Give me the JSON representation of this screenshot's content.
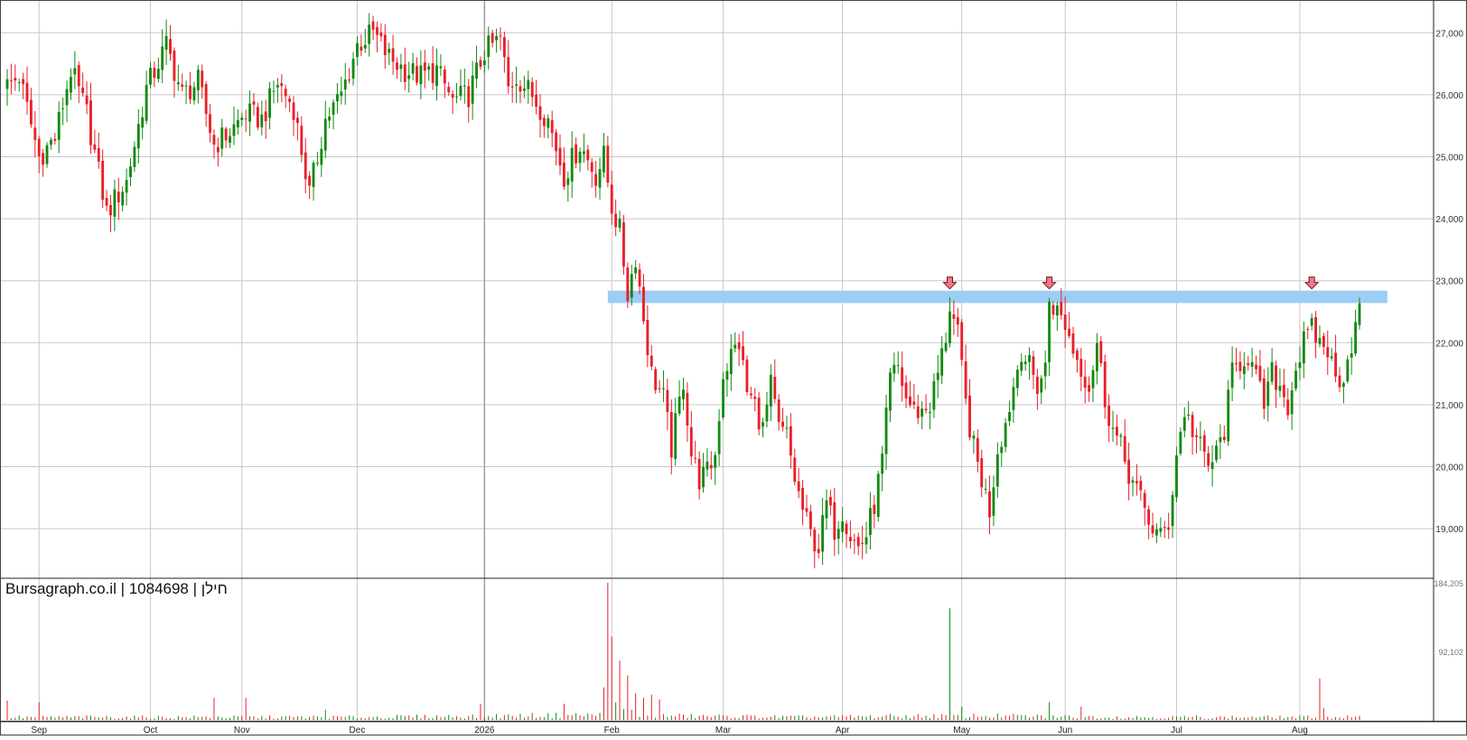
{
  "watermark": "Bursagraph.co.il | 1084698 | חילן",
  "colors": {
    "up": "#138a13",
    "down": "#e8202a",
    "grid": "#c8c8c8",
    "resistance": "#9ccdf5",
    "arrow": "#f07a8a"
  },
  "chart_data": {
    "type": "candlestick",
    "title": "",
    "xlabel": "",
    "ylabel": "",
    "grid": true,
    "price_axis": {
      "ticks": [
        19000,
        20000,
        21000,
        22000,
        23000,
        24000,
        25000,
        26000,
        27000
      ],
      "tick_labels": [
        "19,000",
        "20,000",
        "21,000",
        "22,000",
        "23,000",
        "24,000",
        "25,000",
        "26,000",
        "27,000"
      ],
      "ylim": [
        18200,
        27500
      ]
    },
    "volume_axis": {
      "ticks": [
        92102,
        184205
      ],
      "tick_labels": [
        "92,102",
        "184,205"
      ],
      "ylim": [
        0,
        184205
      ]
    },
    "x_labels": [
      "Sep",
      "Oct",
      "Nov",
      "Dec",
      "2026",
      "Feb",
      "Mar",
      "Apr",
      "May",
      "Jun",
      "Jul",
      "Aug"
    ],
    "x_label_index": [
      8,
      36,
      59,
      88,
      120,
      152,
      180,
      210,
      240,
      266,
      294,
      325
    ],
    "resistance_zone": {
      "low": 22640,
      "high": 22840,
      "start_index": 151,
      "end_index": 347
    },
    "marker_arrows_index": [
      237,
      262,
      328
    ],
    "close_anchors": [
      [
        0,
        26150
      ],
      [
        3,
        26300
      ],
      [
        8,
        25000
      ],
      [
        12,
        25300
      ],
      [
        16,
        26400
      ],
      [
        20,
        25700
      ],
      [
        25,
        24100
      ],
      [
        30,
        24600
      ],
      [
        35,
        26100
      ],
      [
        40,
        26800
      ],
      [
        44,
        26000
      ],
      [
        48,
        26200
      ],
      [
        52,
        25200
      ],
      [
        56,
        25400
      ],
      [
        60,
        25700
      ],
      [
        64,
        25600
      ],
      [
        68,
        26200
      ],
      [
        72,
        25800
      ],
      [
        76,
        24400
      ],
      [
        80,
        25600
      ],
      [
        84,
        26000
      ],
      [
        88,
        26800
      ],
      [
        92,
        27000
      ],
      [
        96,
        26600
      ],
      [
        100,
        26400
      ],
      [
        104,
        26300
      ],
      [
        108,
        26400
      ],
      [
        112,
        25900
      ],
      [
        116,
        26000
      ],
      [
        120,
        26700
      ],
      [
        124,
        26900
      ],
      [
        126,
        26100
      ],
      [
        128,
        26300
      ],
      [
        132,
        26000
      ],
      [
        136,
        25600
      ],
      [
        140,
        24700
      ],
      [
        144,
        25200
      ],
      [
        148,
        24700
      ],
      [
        150,
        25000
      ],
      [
        152,
        24200
      ],
      [
        154,
        23800
      ],
      [
        156,
        22800
      ],
      [
        158,
        23400
      ],
      [
        160,
        22400
      ],
      [
        162,
        21500
      ],
      [
        165,
        21100
      ],
      [
        167,
        20300
      ],
      [
        170,
        21400
      ],
      [
        172,
        20200
      ],
      [
        174,
        19800
      ],
      [
        176,
        19900
      ],
      [
        178,
        20200
      ],
      [
        180,
        21500
      ],
      [
        182,
        21800
      ],
      [
        184,
        22000
      ],
      [
        186,
        21200
      ],
      [
        188,
        21000
      ],
      [
        190,
        20600
      ],
      [
        192,
        21300
      ],
      [
        194,
        20600
      ],
      [
        196,
        20500
      ],
      [
        198,
        19800
      ],
      [
        200,
        19300
      ],
      [
        202,
        18900
      ],
      [
        204,
        18700
      ],
      [
        206,
        19400
      ],
      [
        208,
        19000
      ],
      [
        210,
        19300
      ],
      [
        212,
        18900
      ],
      [
        214,
        18700
      ],
      [
        216,
        18900
      ],
      [
        218,
        19400
      ],
      [
        220,
        20100
      ],
      [
        222,
        21400
      ],
      [
        224,
        21600
      ],
      [
        226,
        21100
      ],
      [
        228,
        20900
      ],
      [
        230,
        20900
      ],
      [
        232,
        21000
      ],
      [
        234,
        21500
      ],
      [
        236,
        22100
      ],
      [
        237,
        22600
      ],
      [
        239,
        22100
      ],
      [
        241,
        21000
      ],
      [
        243,
        20300
      ],
      [
        245,
        19800
      ],
      [
        247,
        19300
      ],
      [
        249,
        20300
      ],
      [
        251,
        20700
      ],
      [
        253,
        21300
      ],
      [
        255,
        21900
      ],
      [
        257,
        21600
      ],
      [
        259,
        21300
      ],
      [
        261,
        21600
      ],
      [
        262,
        22700
      ],
      [
        264,
        22500
      ],
      [
        266,
        22300
      ],
      [
        268,
        21900
      ],
      [
        270,
        21600
      ],
      [
        272,
        21300
      ],
      [
        274,
        22000
      ],
      [
        276,
        21100
      ],
      [
        278,
        20600
      ],
      [
        280,
        20300
      ],
      [
        282,
        19900
      ],
      [
        284,
        19600
      ],
      [
        286,
        19300
      ],
      [
        288,
        19000
      ],
      [
        290,
        18850
      ],
      [
        292,
        19100
      ],
      [
        294,
        20200
      ],
      [
        296,
        20900
      ],
      [
        298,
        20600
      ],
      [
        300,
        20300
      ],
      [
        302,
        20000
      ],
      [
        304,
        20200
      ],
      [
        306,
        20600
      ],
      [
        308,
        21500
      ],
      [
        310,
        21700
      ],
      [
        312,
        21800
      ],
      [
        314,
        21400
      ],
      [
        316,
        21000
      ],
      [
        318,
        21500
      ],
      [
        320,
        21300
      ],
      [
        322,
        21000
      ],
      [
        324,
        21600
      ],
      [
        326,
        22000
      ],
      [
        328,
        22200
      ],
      [
        330,
        22000
      ],
      [
        332,
        21900
      ],
      [
        334,
        21400
      ],
      [
        336,
        21500
      ],
      [
        338,
        22000
      ],
      [
        340,
        22500
      ]
    ],
    "volume_profile": [
      [
        0,
        4000
      ],
      [
        40,
        4000
      ],
      [
        90,
        4000
      ],
      [
        150,
        7000
      ],
      [
        152,
        18000
      ],
      [
        160,
        6000
      ],
      [
        200,
        4000
      ],
      [
        240,
        6000
      ],
      [
        280,
        4000
      ],
      [
        330,
        4000
      ],
      [
        340,
        4000
      ]
    ],
    "volume_spikes": [
      [
        0,
        26000,
        "down"
      ],
      [
        8,
        24000,
        "down"
      ],
      [
        52,
        30000,
        "down"
      ],
      [
        60,
        30000,
        "down"
      ],
      [
        80,
        14000,
        "up"
      ],
      [
        119,
        22000,
        "down"
      ],
      [
        140,
        22000,
        "down"
      ],
      [
        150,
        44000,
        "down"
      ],
      [
        151,
        184205,
        "down"
      ],
      [
        152,
        112000,
        "down"
      ],
      [
        154,
        80000,
        "down"
      ],
      [
        156,
        60000,
        "down"
      ],
      [
        158,
        36000,
        "down"
      ],
      [
        160,
        30000,
        "down"
      ],
      [
        162,
        34000,
        "down"
      ],
      [
        164,
        28000,
        "down"
      ],
      [
        237,
        150000,
        "up"
      ],
      [
        240,
        18000,
        "up"
      ],
      [
        262,
        24000,
        "up"
      ],
      [
        270,
        18000,
        "down"
      ],
      [
        330,
        56000,
        "down"
      ],
      [
        331,
        16000,
        "down"
      ]
    ]
  }
}
